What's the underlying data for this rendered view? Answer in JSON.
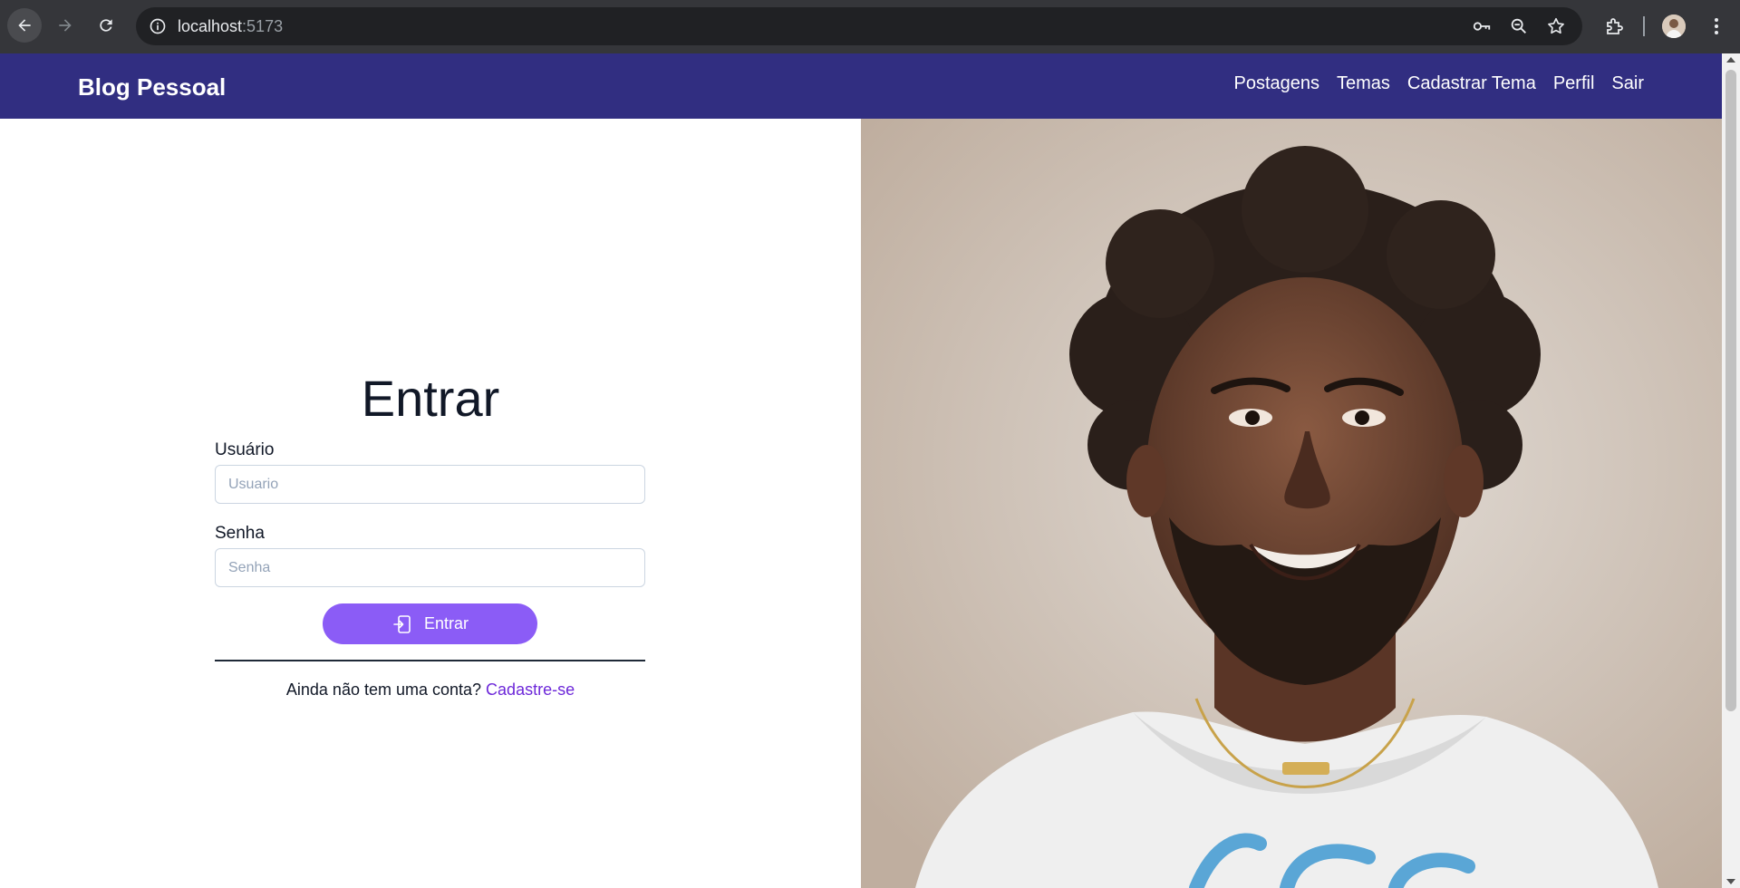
{
  "browser": {
    "url_host": "localhost",
    "url_port": ":5173"
  },
  "navbar": {
    "brand": "Blog Pessoal",
    "links": [
      "Postagens",
      "Temas",
      "Cadastrar Tema",
      "Perfil",
      "Sair"
    ]
  },
  "login": {
    "title": "Entrar",
    "username_label": "Usuário",
    "username_placeholder": "Usuario",
    "username_value": "",
    "password_label": "Senha",
    "password_placeholder": "Senha",
    "password_value": "",
    "submit_label": "Entrar",
    "signup_prompt": "Ainda não tem uma conta?",
    "signup_link": "Cadastre-se"
  },
  "colors": {
    "navbar": "#312e81",
    "button": "#8b5cf6",
    "link": "#6d28d9"
  }
}
